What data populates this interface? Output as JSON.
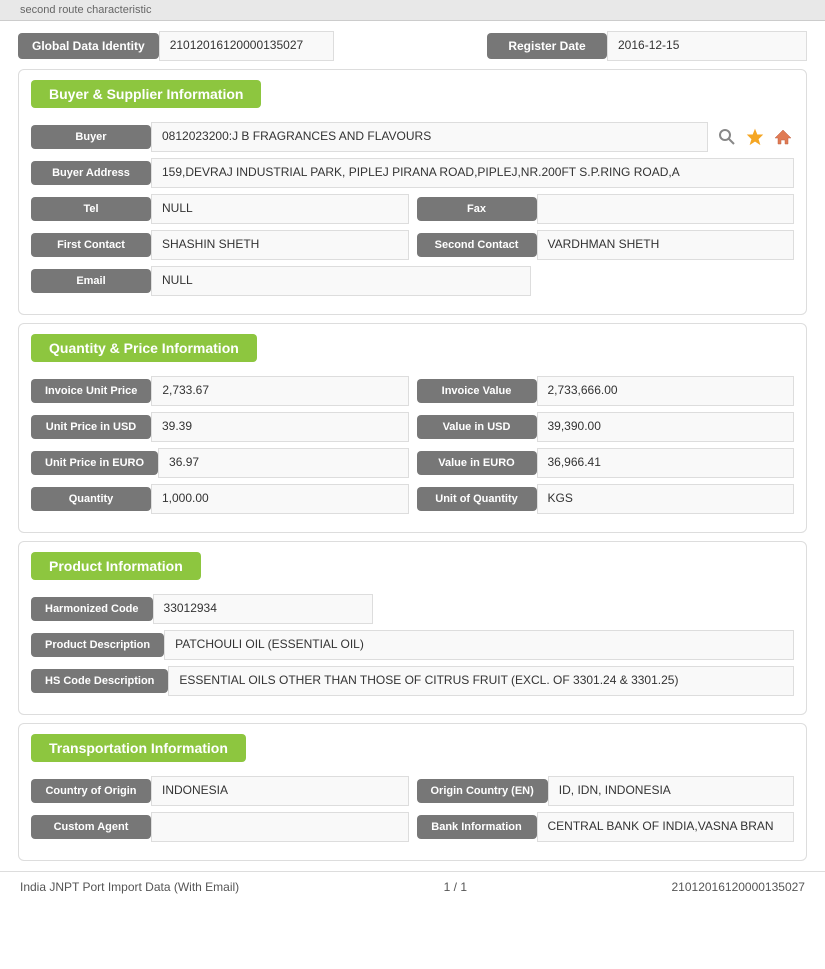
{
  "topbar": {
    "text": "second route characteristic"
  },
  "global": {
    "id_label": "Global Data Identity",
    "id_value": "21012016120000135027",
    "date_label": "Register Date",
    "date_value": "2016-12-15"
  },
  "buyer_section": {
    "title": "Buyer & Supplier Information",
    "buyer_label": "Buyer",
    "buyer_value": "0812023200:J B FRAGRANCES AND FLAVOURS",
    "buyer_address_label": "Buyer Address",
    "buyer_address_value": "159,DEVRAJ INDUSTRIAL PARK, PIPLEJ PIRANA ROAD,PIPLEJ,NR.200FT S.P.RING ROAD,A",
    "tel_label": "Tel",
    "tel_value": "NULL",
    "fax_label": "Fax",
    "fax_value": "",
    "first_contact_label": "First Contact",
    "first_contact_value": "SHASHIN SHETH",
    "second_contact_label": "Second Contact",
    "second_contact_value": "VARDHMAN SHETH",
    "email_label": "Email",
    "email_value": "NULL"
  },
  "quantity_section": {
    "title": "Quantity & Price Information",
    "invoice_unit_price_label": "Invoice Unit Price",
    "invoice_unit_price_value": "2,733.67",
    "invoice_value_label": "Invoice Value",
    "invoice_value_value": "2,733,666.00",
    "unit_price_usd_label": "Unit Price in USD",
    "unit_price_usd_value": "39.39",
    "value_usd_label": "Value in USD",
    "value_usd_value": "39,390.00",
    "unit_price_euro_label": "Unit Price in EURO",
    "unit_price_euro_value": "36.97",
    "value_euro_label": "Value in EURO",
    "value_euro_value": "36,966.41",
    "quantity_label": "Quantity",
    "quantity_value": "1,000.00",
    "unit_quantity_label": "Unit of Quantity",
    "unit_quantity_value": "KGS"
  },
  "product_section": {
    "title": "Product Information",
    "harmonized_code_label": "Harmonized Code",
    "harmonized_code_value": "33012934",
    "product_desc_label": "Product Description",
    "product_desc_value": "PATCHOULI OIL (ESSENTIAL OIL)",
    "hs_code_label": "HS Code Description",
    "hs_code_value": "ESSENTIAL OILS OTHER THAN THOSE OF CITRUS FRUIT (EXCL. OF 3301.24 & 3301.25)"
  },
  "transport_section": {
    "title": "Transportation Information",
    "country_origin_label": "Country of Origin",
    "country_origin_value": "INDONESIA",
    "origin_country_en_label": "Origin Country (EN)",
    "origin_country_en_value": "ID, IDN, INDONESIA",
    "custom_agent_label": "Custom Agent",
    "custom_agent_value": "",
    "bank_info_label": "Bank Information",
    "bank_info_value": "CENTRAL BANK OF INDIA,VASNA BRAN"
  },
  "footer": {
    "left": "India JNPT Port Import Data (With Email)",
    "center": "1 / 1",
    "right": "21012016120000135027"
  }
}
